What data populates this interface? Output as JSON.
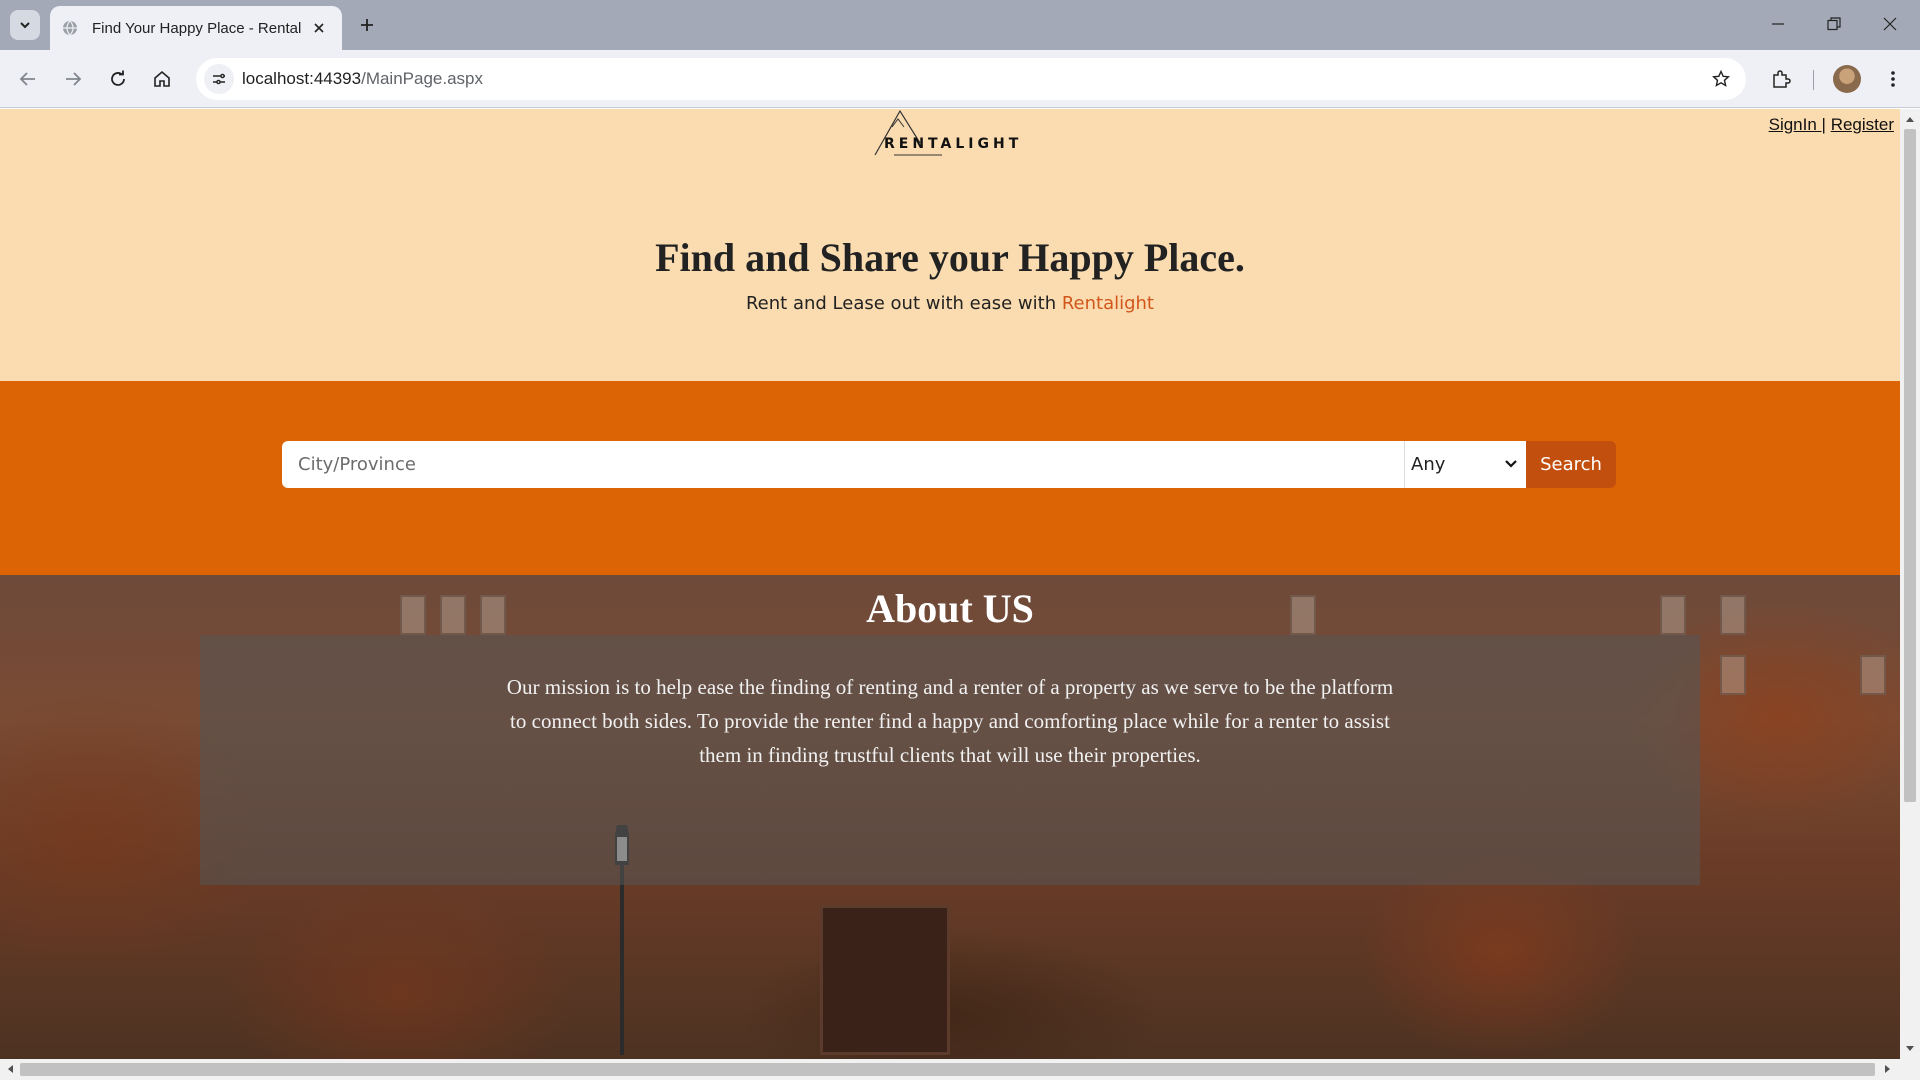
{
  "browser": {
    "tab_title": "Find Your Happy Place - Rentalight",
    "url_host": "localhost:44393",
    "url_path": "/MainPage.aspx",
    "icons": [
      "tab-search-icon",
      "globe-icon",
      "close-icon",
      "plus-icon",
      "minimize-icon",
      "restore-icon",
      "window-close-icon",
      "back-icon",
      "forward-icon",
      "reload-icon",
      "home-icon",
      "site-settings-icon",
      "star-icon",
      "extensions-icon",
      "profile-avatar",
      "kebab-menu-icon"
    ]
  },
  "header": {
    "logo_text": "RENTALIGHT",
    "signin_label": "SignIn |",
    "register_label": "Register"
  },
  "hero": {
    "title": "Find and Share your Happy Place.",
    "subtitle_prefix": "Rent and Lease out with ease with ",
    "subtitle_brand": "Rentalight"
  },
  "search": {
    "placeholder": "City/Province",
    "value": "",
    "type_selected": "Any",
    "button_label": "Search"
  },
  "about": {
    "title": "About US",
    "text": "Our mission is to help ease the finding of renting and a renter of a property as we serve to be the platform to connect both sides. To provide the renter find a happy and comforting place while for a renter to assist them in finding trustful clients that will use their properties."
  },
  "colors": {
    "hero_bg": "#fadcb0",
    "search_band_bg": "#dd6405",
    "search_button_bg": "#c34f0e",
    "brand_accent": "#d2561b",
    "tabstrip_bg": "#a3a9b7"
  }
}
